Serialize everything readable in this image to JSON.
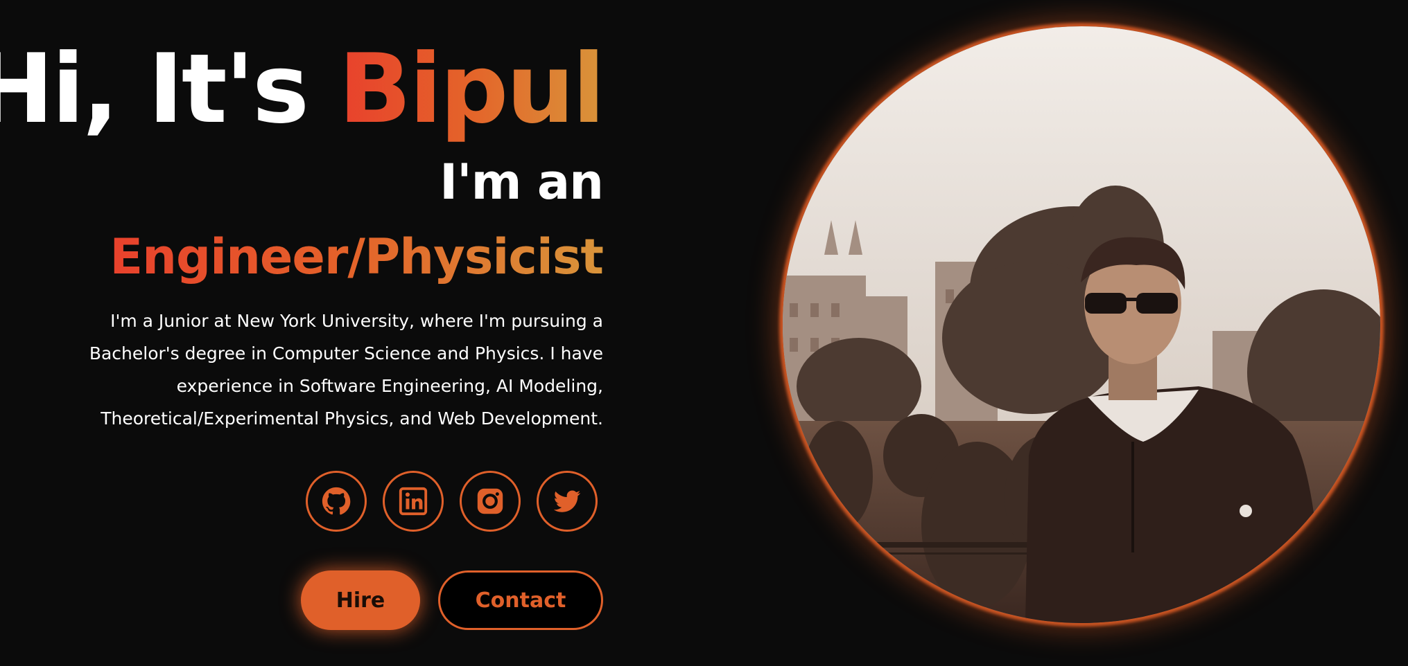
{
  "hero": {
    "greeting_prefix": "Hi, It's ",
    "name": "Bipul",
    "subtitle": "I'm an",
    "role": "Engineer/Physicist",
    "bio": "I'm a Junior at New York University, where I'm pursuing a Bachelor's degree in Computer Science and Physics. I have experience in Software Engineering, AI Modeling, Theoretical/Experimental Physics, and Web Development."
  },
  "socials": [
    {
      "icon": "github-icon"
    },
    {
      "icon": "linkedin-icon"
    },
    {
      "icon": "instagram-icon"
    },
    {
      "icon": "twitter-icon"
    }
  ],
  "buttons": {
    "hire_label": "Hire",
    "contact_label": "Contact"
  },
  "colors": {
    "accent": "#e0602a",
    "gradient_start": "#e8412c",
    "gradient_end": "#d9943a",
    "background": "#0b0b0b",
    "text": "#ffffff"
  }
}
